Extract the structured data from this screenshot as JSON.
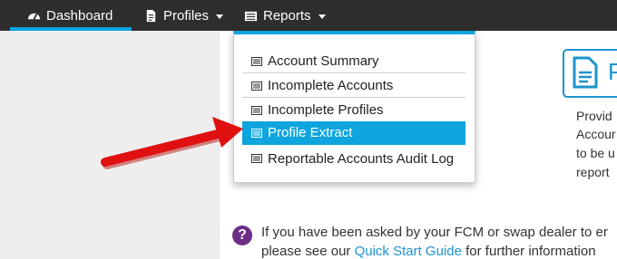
{
  "navbar": {
    "items": [
      {
        "label": "Dashboard",
        "icon": "dashboard-icon"
      },
      {
        "label": "Profiles",
        "icon": "file-icon"
      },
      {
        "label": "Reports",
        "icon": "list-icon"
      }
    ],
    "active_color": "#0ea5df",
    "background": "#2e2e2e"
  },
  "reports_menu": {
    "items": [
      {
        "label": "Account Summary",
        "icon": "list-icon"
      },
      {
        "label": "Incomplete Accounts",
        "icon": "list-icon"
      },
      {
        "label": "Incomplete Profiles",
        "icon": "list-icon"
      },
      {
        "label": "Profile Extract",
        "icon": "list-icon",
        "highlighted": true
      },
      {
        "label": "Reportable Accounts Audit Log",
        "icon": "list-icon"
      }
    ]
  },
  "feature": {
    "title_fragment": "P",
    "description_lines": [
      "Provid",
      "Accour",
      "to be u",
      "report"
    ],
    "accent": "#1c93d0"
  },
  "info": {
    "line1": "If you have been asked by your FCM or swap dealer to er",
    "line2_prefix": "please see our ",
    "link_text": "Quick Start Guide",
    "line2_suffix": " for further information"
  },
  "annotation": {
    "arrow_color": "#e01010"
  }
}
